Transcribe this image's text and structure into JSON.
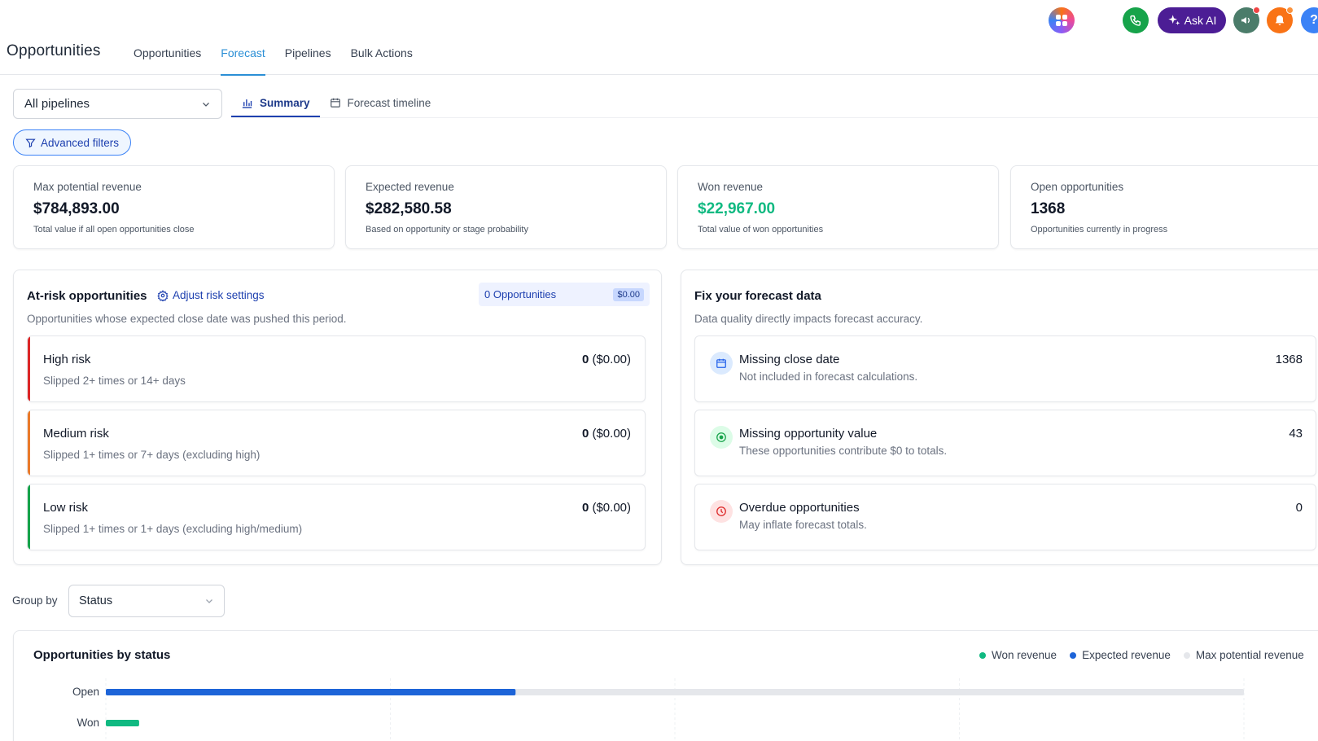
{
  "header": {
    "app_title": "Opportunities",
    "tabs": [
      {
        "label": "Opportunities",
        "active": false
      },
      {
        "label": "Forecast",
        "active": true
      },
      {
        "label": "Pipelines",
        "active": false
      },
      {
        "label": "Bulk Actions",
        "active": false
      }
    ],
    "ask_ai_label": "Ask AI",
    "help_label": "?",
    "icons": [
      "apps-icon",
      "phone-icon",
      "sparkle-icon",
      "megaphone-icon",
      "bell-icon",
      "help-icon"
    ]
  },
  "controls": {
    "pipeline_select": "All pipelines",
    "view_tabs": [
      {
        "label": "Summary",
        "active": true
      },
      {
        "label": "Forecast timeline",
        "active": false
      }
    ],
    "advanced_filters": "Advanced filters"
  },
  "kpis": [
    {
      "label": "Max potential revenue",
      "value": "$784,893.00",
      "sub": "Total value if all open opportunities close",
      "color": "#111827"
    },
    {
      "label": "Expected revenue",
      "value": "$282,580.58",
      "sub": "Based on opportunity or stage probability",
      "color": "#111827"
    },
    {
      "label": "Won revenue",
      "value": "$22,967.00",
      "sub": "Total value of won opportunities",
      "color": "#10b981"
    },
    {
      "label": "Open opportunities",
      "value": "1368",
      "sub": "Opportunities currently in progress",
      "color": "#111827"
    }
  ],
  "at_risk": {
    "title": "At-risk opportunities",
    "adjust_link": "Adjust risk settings",
    "chip_count": "0 Opportunities",
    "chip_amount": "$0.00",
    "description": "Opportunities whose expected close date was pushed this period.",
    "items": [
      {
        "title": "High risk",
        "sub": "Slipped 2+ times or 14+ days",
        "count": "0",
        "amount": "($0.00)",
        "color": "#dc2626"
      },
      {
        "title": "Medium risk",
        "sub": "Slipped 1+ times or 7+ days (excluding high)",
        "count": "0",
        "amount": "($0.00)",
        "color": "#ea7a2a"
      },
      {
        "title": "Low risk",
        "sub": "Slipped 1+ times or 1+ days (excluding high/medium)",
        "count": "0",
        "amount": "($0.00)",
        "color": "#16a34a"
      }
    ]
  },
  "fix_forecast": {
    "title": "Fix your forecast data",
    "description": "Data quality directly impacts forecast accuracy.",
    "items": [
      {
        "title": "Missing close date",
        "sub": "Not included in forecast calculations.",
        "count": "1368",
        "icon": "calendar-icon",
        "color": "#2563eb",
        "bg": "#dbeafe"
      },
      {
        "title": "Missing opportunity value",
        "sub": "These opportunities contribute $0 to totals.",
        "count": "43",
        "icon": "coin-icon",
        "color": "#16a34a",
        "bg": "#dcfce7"
      },
      {
        "title": "Overdue opportunities",
        "sub": "May inflate forecast totals.",
        "count": "0",
        "icon": "clock-icon",
        "color": "#dc2626",
        "bg": "#fee2e2"
      }
    ]
  },
  "group_by": {
    "label": "Group by",
    "value": "Status"
  },
  "status_chart": {
    "title": "Opportunities by status",
    "legend": [
      {
        "label": "Won revenue",
        "color": "#10b981"
      },
      {
        "label": "Expected revenue",
        "color": "#1d64d8"
      },
      {
        "label": "Max potential revenue",
        "color": "#e5e7eb"
      }
    ]
  },
  "chart_data": {
    "type": "bar",
    "orientation": "horizontal",
    "categories": [
      "Open",
      "Won"
    ],
    "series": [
      {
        "name": "Won revenue",
        "values": [
          0,
          22967
        ]
      },
      {
        "name": "Expected revenue",
        "values": [
          282580.58,
          0
        ]
      },
      {
        "name": "Max potential revenue",
        "values": [
          784893,
          0
        ]
      }
    ],
    "xlim": [
      0,
      784893
    ],
    "grid": true,
    "legend_position": "top-right"
  }
}
